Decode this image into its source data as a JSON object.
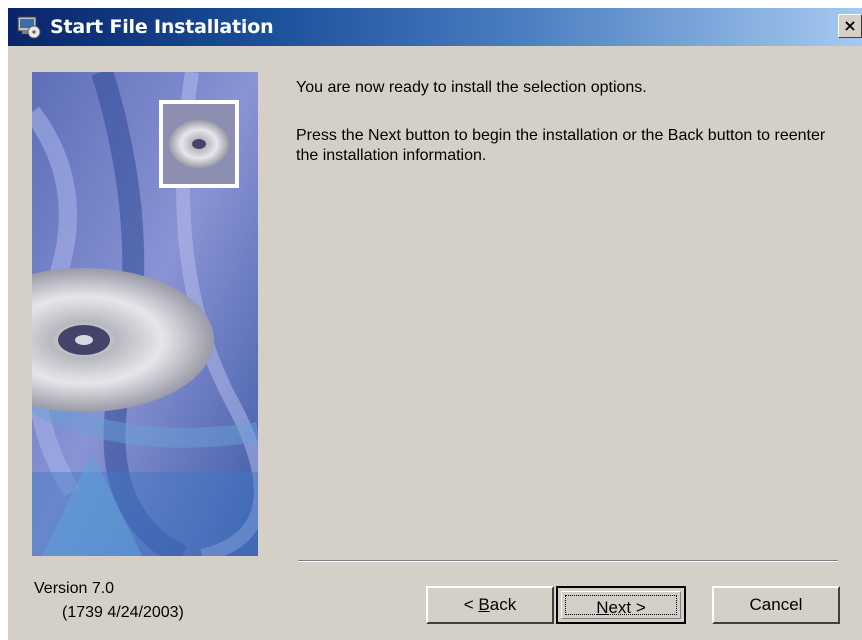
{
  "window": {
    "title": "Start File Installation",
    "close_label": "×"
  },
  "content": {
    "line1": "You are now ready to install the selection options.",
    "line2": "Press the Next button to begin the installation or the Back button to reenter the installation information."
  },
  "footer": {
    "version": "Version 7.0",
    "build": "(1739  4/24/2003)"
  },
  "buttons": {
    "back_prefix": "< ",
    "back_accel": "B",
    "back_rest": "ack",
    "next_accel": "N",
    "next_rest": "ext >",
    "cancel": "Cancel"
  },
  "colors": {
    "face": "#d4d0c8",
    "title_start": "#0a246a",
    "title_end": "#a6caf0"
  }
}
